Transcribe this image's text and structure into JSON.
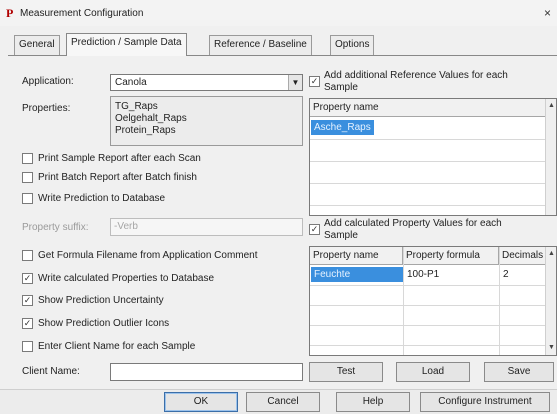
{
  "window": {
    "app_icon": "P",
    "title": "Measurement Configuration",
    "close": "×"
  },
  "tabs": [
    {
      "label": "General"
    },
    {
      "label": "Prediction / Sample Data"
    },
    {
      "label": "Reference / Baseline"
    },
    {
      "label": "Options"
    }
  ],
  "form": {
    "application_label": "Application:",
    "application_value": "Canola",
    "combo_arrow": "▼",
    "properties_label": "Properties:",
    "properties": [
      "TG_Raps",
      "Oelgehalt_Raps",
      "Protein_Raps"
    ],
    "print_sample_report": {
      "label": "Print Sample Report after each Scan",
      "checked": false
    },
    "print_batch_report": {
      "label": "Print Batch Report after Batch finish",
      "checked": false
    },
    "write_prediction": {
      "label": "Write Prediction to Database",
      "checked": false
    },
    "property_suffix_label": "Property suffix:",
    "property_suffix_value": "-Verb",
    "get_formula": {
      "label": "Get Formula Filename from Application Comment",
      "checked": false
    },
    "write_calculated": {
      "label": "Write calculated Properties to Database",
      "checked": true
    },
    "show_uncertainty": {
      "label": "Show Prediction Uncertainty",
      "checked": true
    },
    "show_outlier": {
      "label": "Show Prediction Outlier Icons",
      "checked": true
    },
    "enter_client": {
      "label": "Enter Client Name for each Sample",
      "checked": false
    },
    "client_name_label": "Client Name:",
    "client_name_value": ""
  },
  "reference_values": {
    "checkbox_label_line1": "Add additional Reference Values for each",
    "checkbox_label_line2": "Sample",
    "checked": true,
    "header": "Property name",
    "rows": [
      "Asche_Raps"
    ]
  },
  "calculated_values": {
    "checkbox_label_line1": "Add calculated Property Values for each",
    "checkbox_label_line2": "Sample",
    "checked": true,
    "headers": [
      "Property name",
      "Property formula",
      "Decimals"
    ],
    "rows": [
      {
        "name": "Feuchte",
        "formula": "100-P1",
        "decimals": "2"
      }
    ]
  },
  "grid_buttons": {
    "test": "Test",
    "load": "Load",
    "save": "Save"
  },
  "footer_buttons": {
    "ok": "OK",
    "cancel": "Cancel",
    "help": "Help",
    "configure": "Configure Instrument"
  },
  "checkmark_glyph": "✓",
  "scroll_up": "▲",
  "scroll_down": "▼"
}
